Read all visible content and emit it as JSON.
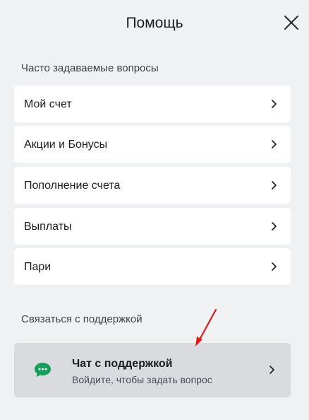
{
  "header": {
    "title": "Помощь"
  },
  "faq": {
    "section_label": "Часто задаваемые вопросы",
    "items": [
      {
        "label": "Мой счет"
      },
      {
        "label": "Акции и Бонусы"
      },
      {
        "label": "Пополнение счета"
      },
      {
        "label": "Выплаты"
      },
      {
        "label": "Пари"
      }
    ]
  },
  "support": {
    "section_label": "Связаться с поддержкой",
    "chat": {
      "title": "Чат с поддержкой",
      "subtitle": "Войдите, чтобы задать вопрос",
      "icon": "chat-bubble-icon"
    }
  },
  "colors": {
    "background": "#f0f1f3",
    "card": "#ffffff",
    "chat_card": "#d9dbde",
    "chat_icon": "#14a05a",
    "annotation_arrow": "#e01b1b"
  }
}
